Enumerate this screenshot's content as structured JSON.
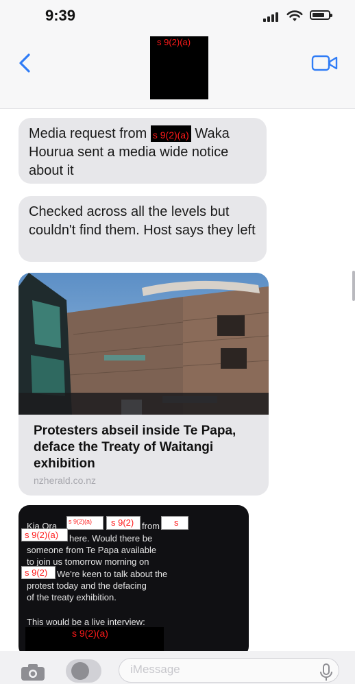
{
  "status_bar": {
    "time": "9:39"
  },
  "header": {
    "contact_redaction": "s 9(2)(a)",
    "back_icon": "chevron-left-icon",
    "video_icon": "video-camera-icon"
  },
  "messages": [
    {
      "text_before": "Media request from ",
      "redaction": "s 9(2)(a)",
      "text_after": " Waka Hourua sent a media wide notice about it"
    },
    {
      "text": "Checked across all the levels but couldn't find them. Host says they left"
    }
  ],
  "link_preview": {
    "title": "Protesters abseil inside Te Papa, deface the Treaty of Waitangi exhibition",
    "domain": "nzherald.co.nz"
  },
  "screenshot_message": {
    "line1_start": "Kia Ora",
    "line1_redaction_a": "s 9(2)(a)",
    "line1_redaction_b": "s 9(2)",
    "line1_mid": "from",
    "line1_redaction_c": "s",
    "line2_redaction": "s 9(2)(a)",
    "line2_text": "here. Would there be",
    "line3": "someone from Te Papa available",
    "line4": "to join us tomorrow morning on",
    "line5_redaction": "s 9(2)",
    "line5_text": "We're keen to talk about the",
    "line6": "protest today and the defacing",
    "line7": "of the treaty exhibition.",
    "line8": "This would be a live interview:",
    "bottom_redaction": "s 9(2)(a)"
  },
  "input_bar": {
    "placeholder": "iMessage",
    "camera_icon": "camera-icon",
    "apps_icon": "app-store-icon",
    "mic_icon": "microphone-icon"
  },
  "colors": {
    "accent": "#2f7cf6",
    "bubble": "#e7e7ea",
    "redaction_text": "#ff1a1a"
  }
}
